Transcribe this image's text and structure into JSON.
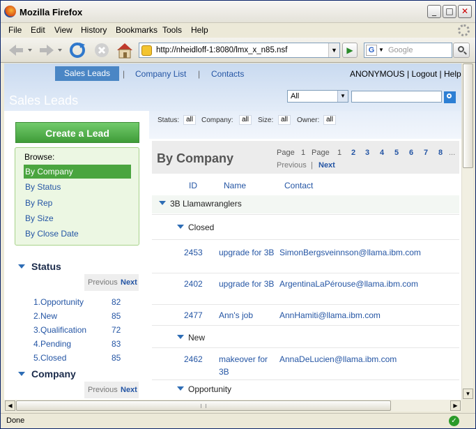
{
  "window": {
    "title": "Mozilla Firefox"
  },
  "menubar": [
    "File",
    "Edit",
    "View",
    "History",
    "Bookmarks",
    "Tools",
    "Help"
  ],
  "urlbar": {
    "url": "http://nheidloff-1:8080/lmx_x_n85.nsf"
  },
  "search": {
    "placeholder": "Google",
    "engine_letter": "G"
  },
  "topnav": {
    "sales_leads": "Sales Leads",
    "company_list": "Company List",
    "contacts": "Contacts",
    "sep": "|"
  },
  "userbar": {
    "user": "ANONYMOUS",
    "logout": "Logout",
    "help": "Help",
    "sep": "|"
  },
  "page_heading": "Sales Leads",
  "filter_select": "All",
  "left": {
    "create_lead": "Create a Lead",
    "browse_title": "Browse:",
    "browse_items": [
      "By Company",
      "By Status",
      "By Rep",
      "By Size",
      "By Close Date"
    ],
    "status_title": "Status",
    "status_pager": {
      "previous": "Previous",
      "next": "Next"
    },
    "status_rows": [
      {
        "name": "1.Opportunity",
        "count": "82"
      },
      {
        "name": "2.New",
        "count": "85"
      },
      {
        "name": "3.Qualification",
        "count": "72"
      },
      {
        "name": "4.Pending",
        "count": "83"
      },
      {
        "name": "5.Closed",
        "count": "85"
      }
    ],
    "company_title": "Company",
    "company_pager": {
      "previous": "Previous",
      "next": "Next"
    }
  },
  "filters": {
    "status_label": "Status:",
    "status_value": "all",
    "company_label": "Company:",
    "company_value": "all",
    "size_label": "Size:",
    "size_value": "all",
    "owner_label": "Owner:",
    "owner_value": "all"
  },
  "view": {
    "title": "By Company",
    "page_label1": "Page",
    "page_current": "1",
    "page_label2": "Page",
    "page_of": "1",
    "pages": [
      "1",
      "2",
      "3",
      "4",
      "5",
      "6",
      "7",
      "8"
    ],
    "ellipsis": "...",
    "previous": "Previous",
    "next": "Next",
    "columns": [
      "ID",
      "Name",
      "Contact"
    ],
    "company": "3B Llamawranglers",
    "groups": [
      "Closed",
      "New",
      "Opportunity"
    ],
    "rows": [
      {
        "id": "2453",
        "name": "upgrade for 3B",
        "contact": "SimonBergsveinnson@llama.ibm.com"
      },
      {
        "id": "2402",
        "name": "upgrade for 3B",
        "contact": "ArgentinaLaPérouse@llama.ibm.com"
      },
      {
        "id": "2477",
        "name": "Ann's job",
        "contact": "AnnHamiti@llama.ibm.com"
      },
      {
        "id": "2462",
        "name": "makeover for 3B",
        "contact": "AnnaDeLucien@llama.ibm.com"
      }
    ]
  },
  "status": {
    "text": "Done"
  }
}
